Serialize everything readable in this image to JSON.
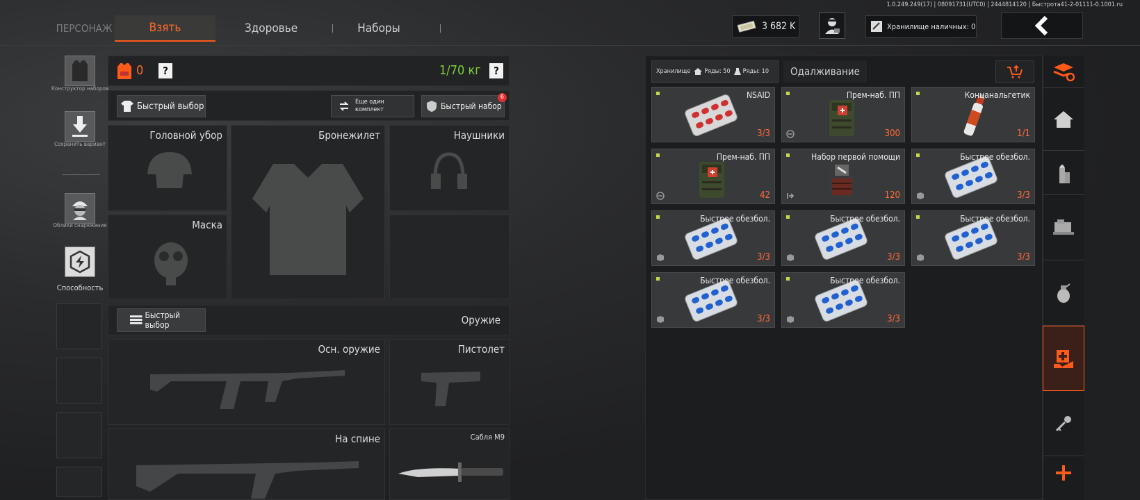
{
  "version": "1.0.249.249(17) | 08091731(UTC0) | 2444814120 | Быстрота41-2-01111-0.1001.ru",
  "tabs": {
    "character": "ПЕРСОНАЖ",
    "take": "Взять",
    "health": "Здоровье",
    "sets": "Наборы"
  },
  "currency": {
    "money": "3 682 K",
    "cash_storage": "Хранилище наличных: 0"
  },
  "left_sidebar": {
    "kit_builder": "Конструктор наборов",
    "save_variant": "Сохранить вариант",
    "gear_skins": "Облики снаряжения",
    "ability": "Способность"
  },
  "equip": {
    "armor_count": "0",
    "help": "?",
    "weight": "1/70 кг",
    "quick_select": "Быстрый выбор",
    "another_set": "Еще один комплект",
    "quick_set": "Быстрый набор",
    "quick_set_badge": "6",
    "slots": {
      "headgear": "Головной убор",
      "vest": "Бронежилет",
      "headphones": "Наушники",
      "mask": "Маска",
      "weapon_header": "Оружие",
      "primary": "Осн. оружие",
      "pistol": "Пистолет",
      "back": "На спине",
      "melee": "Сабля М9"
    }
  },
  "storage": {
    "label": "Хранилище",
    "rows_home": "Ряды: 50",
    "rows_other": "Ряды: 10",
    "loan_tab": "Одалживание",
    "items": [
      {
        "name": "NSAID",
        "count": "3/3",
        "icon": "pills-red"
      },
      {
        "name": "Прем-наб. ПП",
        "count": "300",
        "icon": "medkit-green"
      },
      {
        "name": "Концанальгетик",
        "count": "1/1",
        "icon": "spray"
      },
      {
        "name": "Прем-наб. ПП",
        "count": "42",
        "icon": "medkit-green"
      },
      {
        "name": "Набор первой помощи",
        "count": "120",
        "icon": "medkit-red"
      },
      {
        "name": "Быстрое обезбол.",
        "count": "3/3",
        "icon": "pills-blue"
      },
      {
        "name": "Быстрое обезбол.",
        "count": "3/3",
        "icon": "pills-blue"
      },
      {
        "name": "Быстрое обезбол.",
        "count": "3/3",
        "icon": "pills-blue"
      },
      {
        "name": "Быстрое обезбол.",
        "count": "3/3",
        "icon": "pills-blue"
      },
      {
        "name": "Быстрое обезбол.",
        "count": "3/3",
        "icon": "pills-blue"
      },
      {
        "name": "Быстрое обезбол.",
        "count": "3/3",
        "icon": "pills-blue"
      }
    ]
  },
  "colors": {
    "accent": "#ff5a1a",
    "weight": "#7fd03a",
    "count": "#ff6a3a"
  }
}
